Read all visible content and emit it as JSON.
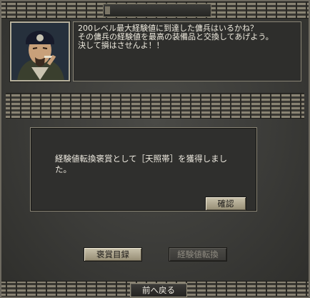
{
  "npc": {
    "speech": "200レベル最大経験値に到達した傭兵はいるかね？\nその傭兵の経験値を最高の装備品と交換してあげよう。\n決して損はさせんよ！！"
  },
  "dialog": {
    "message": "経験値転換褒賞として［天照帯］を獲得しました。",
    "confirm_label": "確認"
  },
  "buttons": {
    "reward_list": "褒賞目録",
    "exp_convert": "経験値転換",
    "back": "前へ戻る"
  }
}
